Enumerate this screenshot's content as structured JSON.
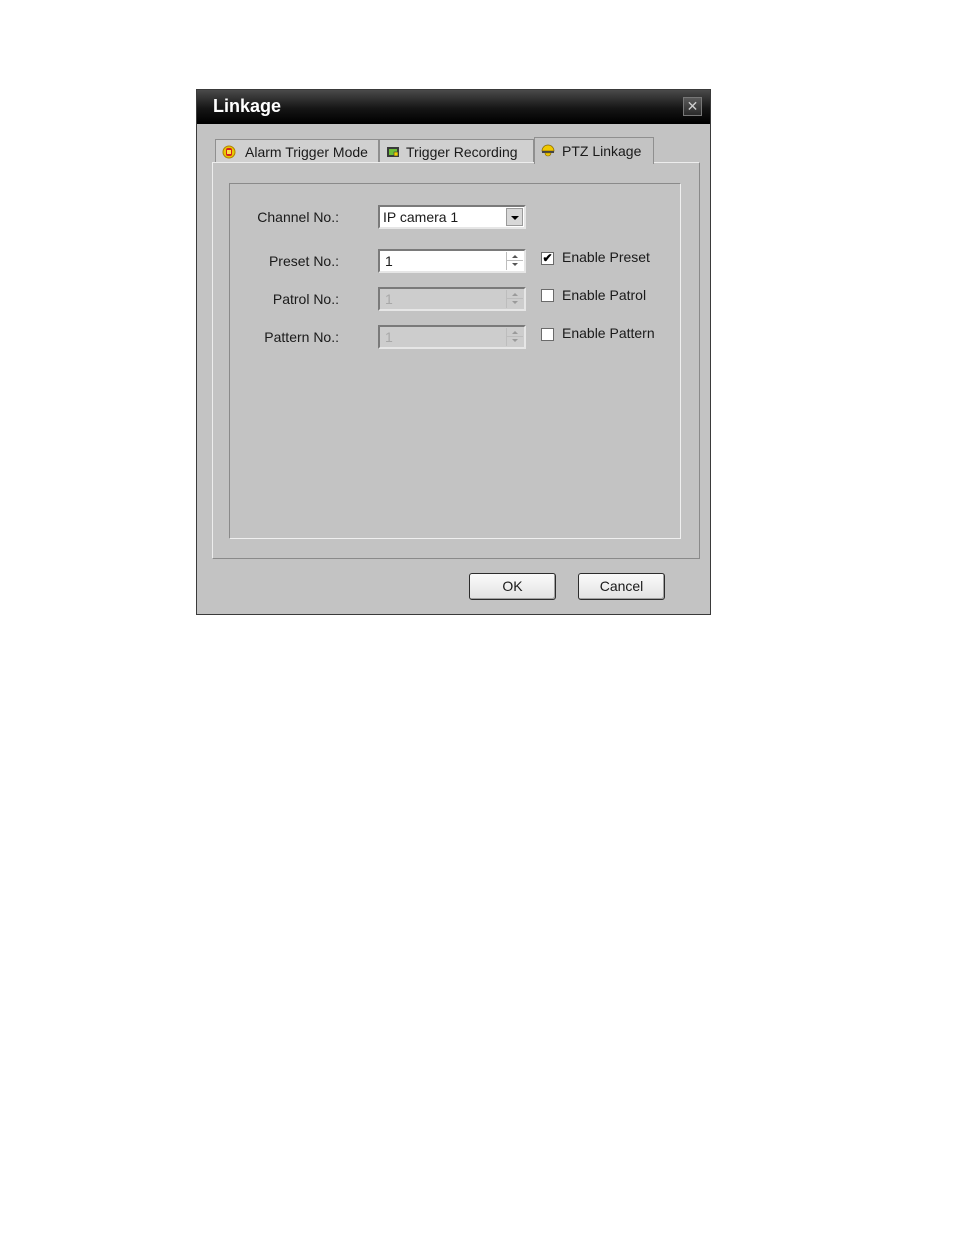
{
  "dialog": {
    "title": "Linkage",
    "close_glyph": "✕"
  },
  "tabs": [
    {
      "label": "Alarm Trigger Mode",
      "icon": "hand-alarm-icon",
      "active": false
    },
    {
      "label": "Trigger Recording",
      "icon": "recording-icon",
      "active": false
    },
    {
      "label": "PTZ Linkage",
      "icon": "ptz-dome-icon",
      "active": true
    }
  ],
  "form": {
    "channel": {
      "label": "Channel No.:",
      "value": "IP camera 1"
    },
    "preset": {
      "label": "Preset No.:",
      "value": "1",
      "check_label": "Enable Preset",
      "checked": true,
      "check_glyph": "✔"
    },
    "patrol": {
      "label": "Patrol No.:",
      "value": "1",
      "check_label": "Enable Patrol",
      "checked": false
    },
    "pattern": {
      "label": "Pattern No.:",
      "value": "1",
      "check_label": "Enable Pattern",
      "checked": false
    }
  },
  "buttons": {
    "ok": "OK",
    "cancel": "Cancel"
  },
  "colors": {
    "dialog_bg": "#c3c3c3",
    "titlebar": "#1a1a1a",
    "alarm_icon": "#e8c800",
    "ptz_icon": "#f0c800"
  }
}
